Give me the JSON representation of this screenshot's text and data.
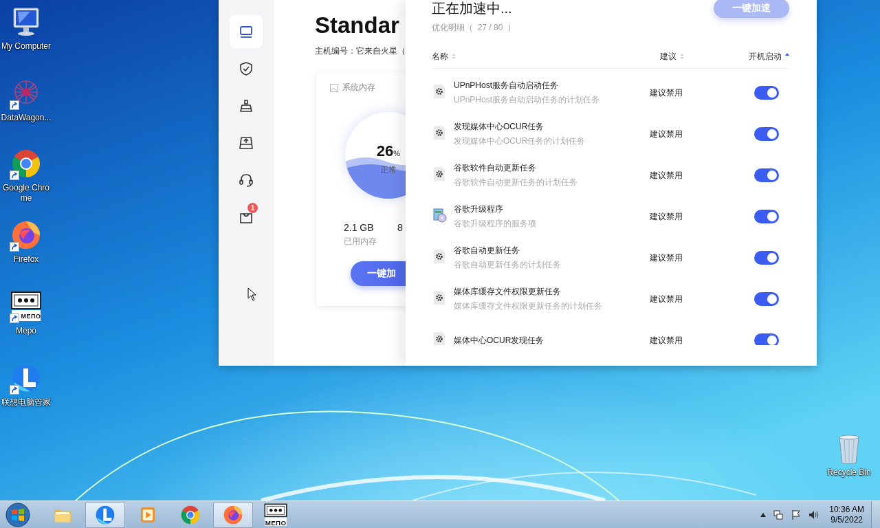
{
  "desktop_icons": [
    {
      "kind": "computer",
      "label": "My Computer",
      "shortcut": false
    },
    {
      "kind": "datawagon",
      "label": "DataWagon...",
      "shortcut": true
    },
    {
      "kind": "chrome",
      "label": "Google Chrome",
      "shortcut": true
    },
    {
      "kind": "firefox",
      "label": "Firefox",
      "shortcut": true
    },
    {
      "kind": "mepo",
      "label": "Mepo",
      "shortcut": true,
      "icon_text": "МЕПО"
    },
    {
      "kind": "lenovo",
      "label": "联想电脑管家",
      "shortcut": true
    },
    {
      "kind": "recycle",
      "label": "Recycle Bin",
      "shortcut": false
    }
  ],
  "app": {
    "sidebar": [
      {
        "kind": "monitor",
        "selected": true
      },
      {
        "kind": "shield",
        "selected": false
      },
      {
        "kind": "broom",
        "selected": false
      },
      {
        "kind": "drive",
        "selected": false
      },
      {
        "kind": "headset",
        "selected": false
      },
      {
        "kind": "bag",
        "selected": false,
        "badge": "1"
      }
    ],
    "title": "Standar",
    "host": "主机编号：它来自火星（",
    "card": {
      "title": "系统内存",
      "percent": "26",
      "unit": "%",
      "status": "正常",
      "stats": [
        {
          "value": "2.1 GB",
          "label": "已用内存"
        },
        {
          "value": "8"
        }
      ],
      "button": "一键加"
    }
  },
  "drawer": {
    "title": "正在加速中...",
    "subtitle": "优化明细（  27 / 80  ）",
    "button": {
      "label": "一键加速",
      "disabled": true
    },
    "columns": [
      {
        "label": "名称",
        "sorted": false
      },
      {
        "label": "建议",
        "sorted": false
      },
      {
        "label": "开机启动",
        "sorted": true
      }
    ],
    "rows": [
      {
        "kind": "gear",
        "name": "UPnPHost服务自动启动任务",
        "description": "UPnPHost服务自动启动任务的计划任务",
        "advice": "建议禁用",
        "on": true
      },
      {
        "kind": "gear",
        "name": "发现媒体中心OCUR任务",
        "description": "发现媒体中心OCUR任务的计划任务",
        "advice": "建议禁用",
        "on": true
      },
      {
        "kind": "gear",
        "name": "谷歌软件自动更新任务",
        "description": "谷歌软件自动更新任务的计划任务",
        "advice": "建议禁用",
        "on": true
      },
      {
        "kind": "installer",
        "name": "谷歌升级程序",
        "description": "谷歌升级程序的服务项",
        "advice": "建议禁用",
        "on": true
      },
      {
        "kind": "gear",
        "name": "谷歌自动更新任务",
        "description": "谷歌自动更新任务的计划任务",
        "advice": "建议禁用",
        "on": true
      },
      {
        "kind": "gear",
        "name": "媒体库缓存文件权限更新任务",
        "description": "媒体库缓存文件权限更新任务的计划任务",
        "advice": "建议禁用",
        "on": true
      },
      {
        "kind": "gear",
        "name": "媒体中心OCUR发现任务",
        "advice": "建议禁用",
        "on": true
      }
    ]
  },
  "taskbar": {
    "items": [
      {
        "kind": "explorer",
        "selected": false
      },
      {
        "kind": "lenovo",
        "selected": true
      },
      {
        "kind": "media",
        "selected": false
      },
      {
        "kind": "chrome",
        "selected": false
      },
      {
        "kind": "firefox",
        "selected": true
      },
      {
        "kind": "mepo",
        "selected": false,
        "icon_text": "МЕПО"
      }
    ],
    "tray": {
      "time": "10:36 AM",
      "date": "9/5/2022"
    }
  }
}
